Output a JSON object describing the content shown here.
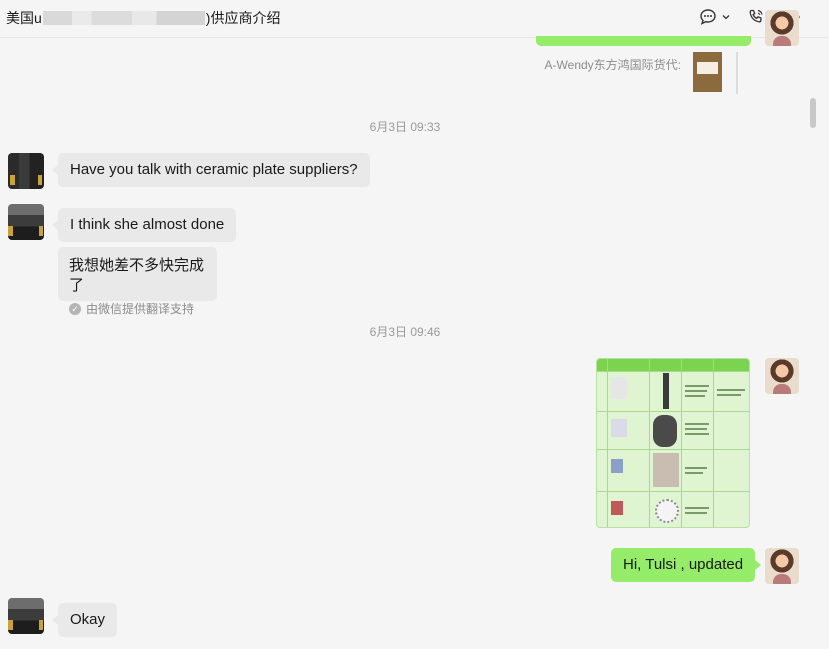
{
  "header": {
    "title_prefix": "美国u",
    "title_suffix": ")供应商介绍",
    "icons": [
      "chat-bubble-icon",
      "chevron-down-icon",
      "phone-icon",
      "more-icon"
    ]
  },
  "quoted": {
    "label": "A-Wendy东方鸿国际货代:"
  },
  "timestamps": [
    "6月3日 09:33",
    "6月3日 09:46"
  ],
  "messages": {
    "m1": "Have you talk with ceramic plate suppliers?",
    "m2": "I think she almost done",
    "m2_translation": "我想她差不多快完成了",
    "translation_note": "由微信提供翻译支持",
    "m3": "Hi, Tulsi , updated",
    "m4": "Okay"
  },
  "colors": {
    "outgoing_bubble": "#95ec69",
    "incoming_bubble": "#e9e9e9",
    "background": "#f5f5f5"
  }
}
